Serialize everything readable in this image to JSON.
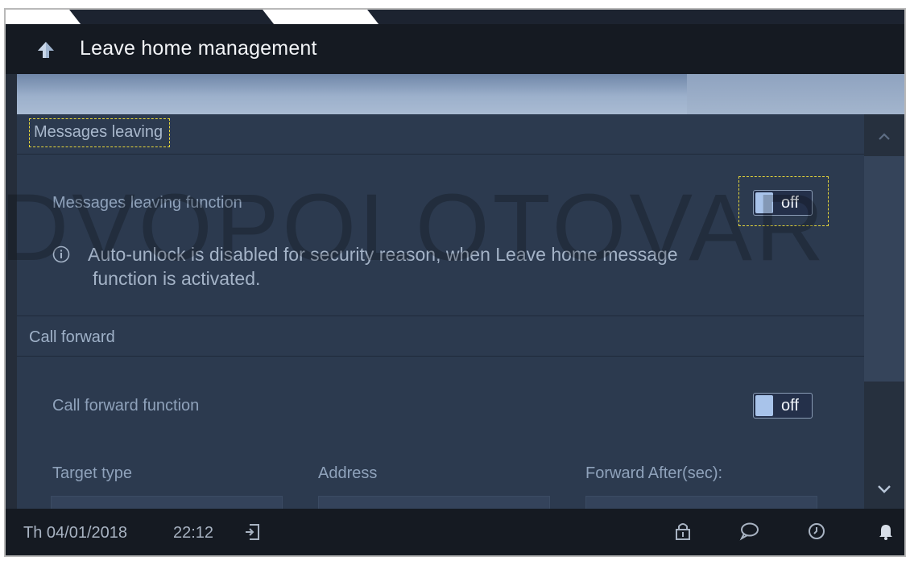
{
  "header": {
    "title": "Leave home management"
  },
  "sections": [
    {
      "title": "Messages leaving",
      "row_label": "Messages leaving function",
      "toggle_state": "off",
      "info_line_1": "Auto-unlock is disabled for security reason, when Leave home message",
      "info_line_2": "function is activated."
    },
    {
      "title": "Call forward",
      "row_label": "Call forward function",
      "toggle_state": "off",
      "columns": [
        "Target type",
        "Address",
        "Forward After(sec):"
      ]
    }
  ],
  "statusbar": {
    "date": "Th 04/01/2018",
    "time": "22:12"
  },
  "watermark": "DVOPOLOTOVAR",
  "colors": {
    "accent": "#a8c3ea",
    "focus": "#e8d83a",
    "panel": "#2c3a4f",
    "bar": "#151a22"
  }
}
